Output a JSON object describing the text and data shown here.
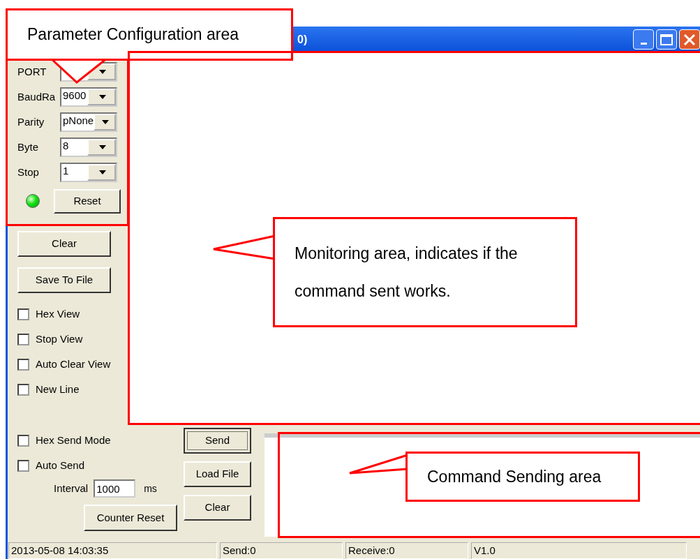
{
  "window": {
    "title": "0)"
  },
  "config": [
    {
      "label": "PORT"
    },
    {
      "label": "BaudRa",
      "value": "9600"
    },
    {
      "label": "Parity",
      "value": "pNone"
    },
    {
      "label": "Byte",
      "value": "8"
    },
    {
      "label": "Stop",
      "value": "1"
    }
  ],
  "port_led": {
    "on": true
  },
  "reset_button": "Reset",
  "view_buttons": [
    "Clear",
    "Save To File"
  ],
  "view_options": [
    {
      "label": "Hex View",
      "checked": false
    },
    {
      "label": "Stop View",
      "checked": false
    },
    {
      "label": "Auto Clear View",
      "checked": false
    },
    {
      "label": "New Line",
      "checked": false
    }
  ],
  "send_options": [
    {
      "label": "Hex Send Mode",
      "checked": false
    },
    {
      "label": "Auto Send",
      "checked": false
    }
  ],
  "interval": {
    "label": "Interval",
    "value": "1000",
    "unit": "ms"
  },
  "counter_reset": "Counter Reset",
  "send_buttons": [
    {
      "label": "Send",
      "focused": true
    },
    {
      "label": "Load File",
      "focused": false
    },
    {
      "label": "Clear",
      "focused": false
    }
  ],
  "status_bar": [
    "2013-05-08 14:03:35",
    "Send:0",
    "Receive:0",
    "V1.0"
  ],
  "annotations": [
    {
      "kind": "config",
      "text": "Parameter Configuration area"
    },
    {
      "kind": "monitor",
      "text": "Monitoring area, indicates if the command sent works."
    },
    {
      "kind": "send",
      "text": "Command Sending area"
    }
  ]
}
